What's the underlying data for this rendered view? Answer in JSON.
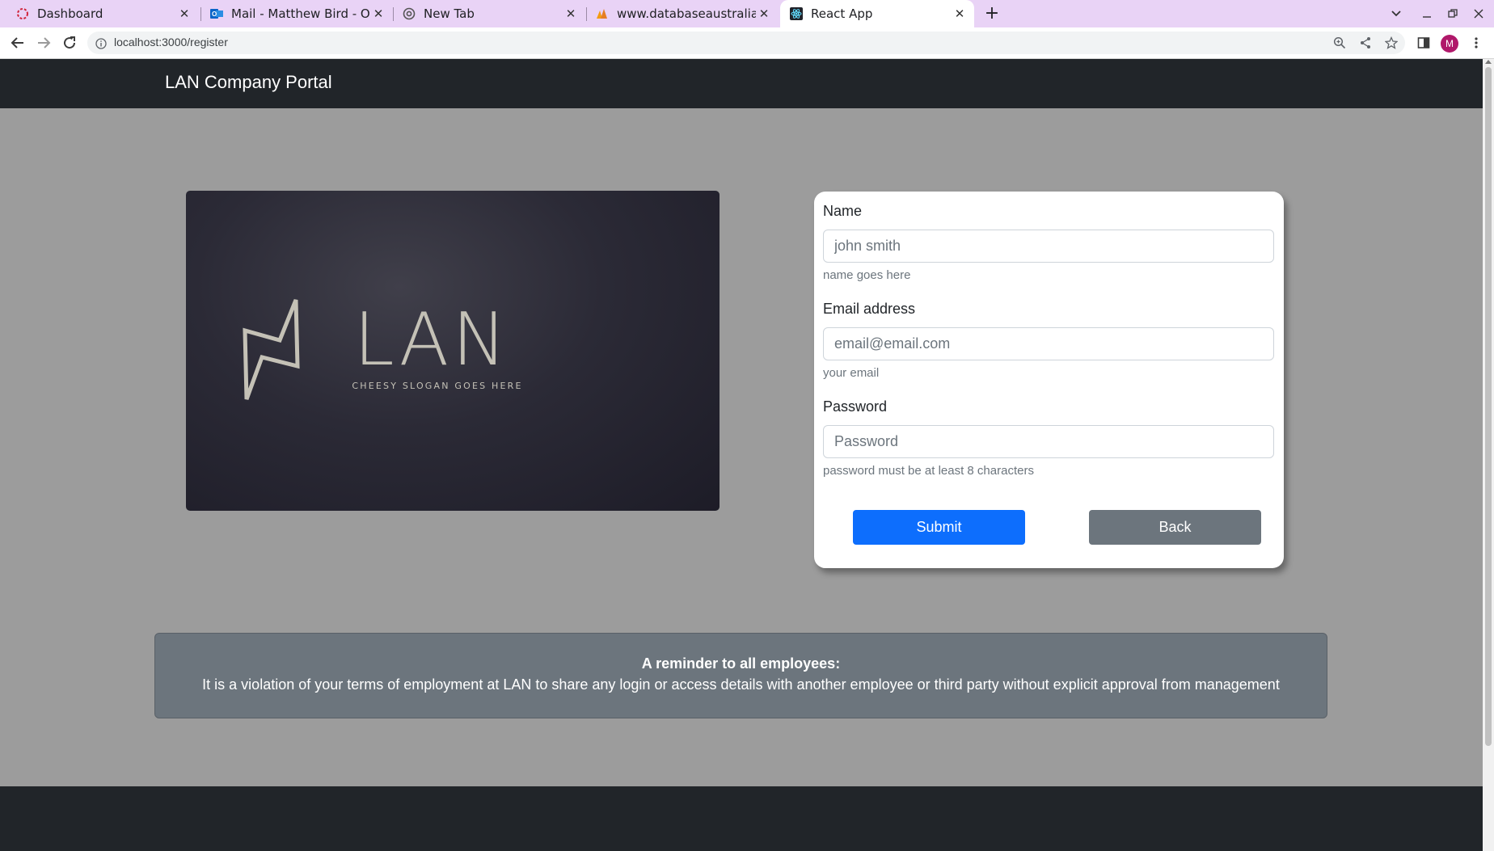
{
  "browser": {
    "tabs": [
      {
        "title": "Dashboard",
        "icon": "spinner-ring-icon",
        "active": false
      },
      {
        "title": "Mail - Matthew Bird - Outl",
        "icon": "outlook-icon",
        "active": false
      },
      {
        "title": "New Tab",
        "icon": "chrome-icon",
        "active": false
      },
      {
        "title": "www.databaseaustralia.c",
        "icon": "database-australia-icon",
        "active": false
      },
      {
        "title": "React App",
        "icon": "react-icon",
        "active": true
      }
    ],
    "url": "localhost:3000/register",
    "profile_initial": "M"
  },
  "navbar": {
    "brand": "LAN Company Portal"
  },
  "hero": {
    "logo_text": "LAN",
    "slogan": "CHEESY SLOGAN GOES HERE"
  },
  "form": {
    "name": {
      "label": "Name",
      "placeholder": "john smith",
      "help": "name goes here"
    },
    "email": {
      "label": "Email address",
      "placeholder": "email@email.com",
      "help": "your email"
    },
    "password": {
      "label": "Password",
      "placeholder": "Password",
      "help": "password must be at least 8 characters"
    },
    "submit_label": "Submit",
    "back_label": "Back"
  },
  "notice": {
    "title": "A reminder to all employees:",
    "body": "It is a violation of your terms of employment at LAN to share any login or access details with another employee or third party without explicit approval from management"
  },
  "colors": {
    "navbar": "#212529",
    "page_bg": "#9c9c9c",
    "primary": "#0d6efd",
    "secondary": "#6c757d",
    "tab_strip": "#e9d3f6"
  }
}
